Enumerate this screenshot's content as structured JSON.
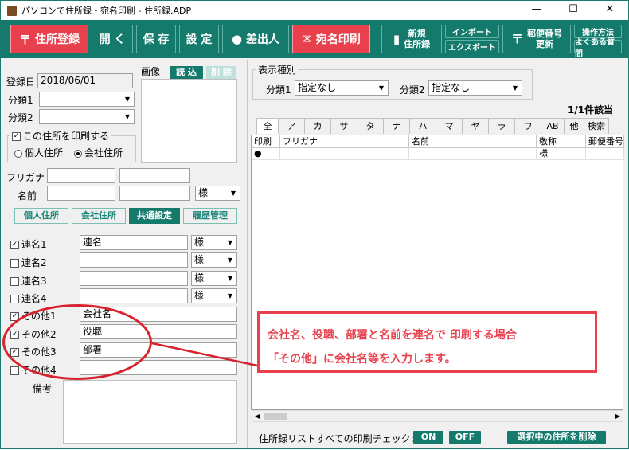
{
  "window": {
    "title": "パソコンで住所録・宛名印刷 - 住所録.ADP",
    "minimize": "—",
    "maximize": "☐",
    "close": "✕"
  },
  "toolbar": {
    "register": "住所登録",
    "open": "開 く",
    "save": "保 存",
    "settings": "設 定",
    "sender": "差出人",
    "print": "宛名印刷",
    "new_book_1": "新規",
    "new_book_2": "住所録",
    "import": "インポート",
    "export": "エクスポート",
    "postal_1": "郵便番号",
    "postal_2": "更新",
    "manual": "操作方法",
    "faq": "よくある質問"
  },
  "form": {
    "reg_date_label": "登録日",
    "reg_date_value": "2018/06/01",
    "cat1_label": "分類1",
    "cat2_label": "分類2",
    "image_label": "画像",
    "image_load": "読 込",
    "image_delete": "削 除",
    "print_group_label": "この住所を印刷する",
    "radio_personal": "個人住所",
    "radio_company": "会社住所",
    "furigana_label": "フリガナ",
    "name_label": "名前",
    "honorific": "様",
    "tab_personal": "個人住所",
    "tab_company": "会社住所",
    "tab_common": "共通設定",
    "tab_history": "履歴管理",
    "joint_rows": [
      {
        "label": "連名1",
        "checked": true,
        "value": "連名",
        "honorific": "様"
      },
      {
        "label": "連名2",
        "checked": false,
        "value": "",
        "honorific": "様"
      },
      {
        "label": "連名3",
        "checked": false,
        "value": "",
        "honorific": "様"
      },
      {
        "label": "連名4",
        "checked": false,
        "value": "",
        "honorific": "様"
      }
    ],
    "other_rows": [
      {
        "label": "その他1",
        "checked": true,
        "value": "会社名"
      },
      {
        "label": "その他2",
        "checked": true,
        "value": "役職"
      },
      {
        "label": "その他3",
        "checked": true,
        "value": "部署"
      },
      {
        "label": "その他4",
        "checked": false,
        "value": ""
      }
    ],
    "notes_label": "備考"
  },
  "display": {
    "group_label": "表示種別",
    "cat1_label": "分類1",
    "cat1_value": "指定なし",
    "cat2_label": "分類2",
    "cat2_value": "指定なし",
    "count": "1/1件該当"
  },
  "index_tabs": [
    "全",
    "ア",
    "カ",
    "サ",
    "タ",
    "ナ",
    "ハ",
    "マ",
    "ヤ",
    "ラ",
    "ワ",
    "AB",
    "他",
    "検索"
  ],
  "grid": {
    "headers": [
      "印刷",
      "フリガナ",
      "名前",
      "敬称",
      "郵便番号"
    ],
    "rows": [
      {
        "print": "●",
        "furigana": "",
        "name": "",
        "honorific": "様",
        "postal": ""
      }
    ]
  },
  "footer": {
    "check_label": "住所録リストすべての印刷チェック:",
    "on": "ON",
    "off": "OFF",
    "delete_selected": "選択中の住所を削除"
  },
  "annotation": {
    "line1": "会社名、役職、部署と名前を連名で 印刷する場合",
    "line2": "「その他」に会社名等を入力します。"
  },
  "colors": {
    "teal": "#137a6c",
    "red": "#e8414d"
  }
}
